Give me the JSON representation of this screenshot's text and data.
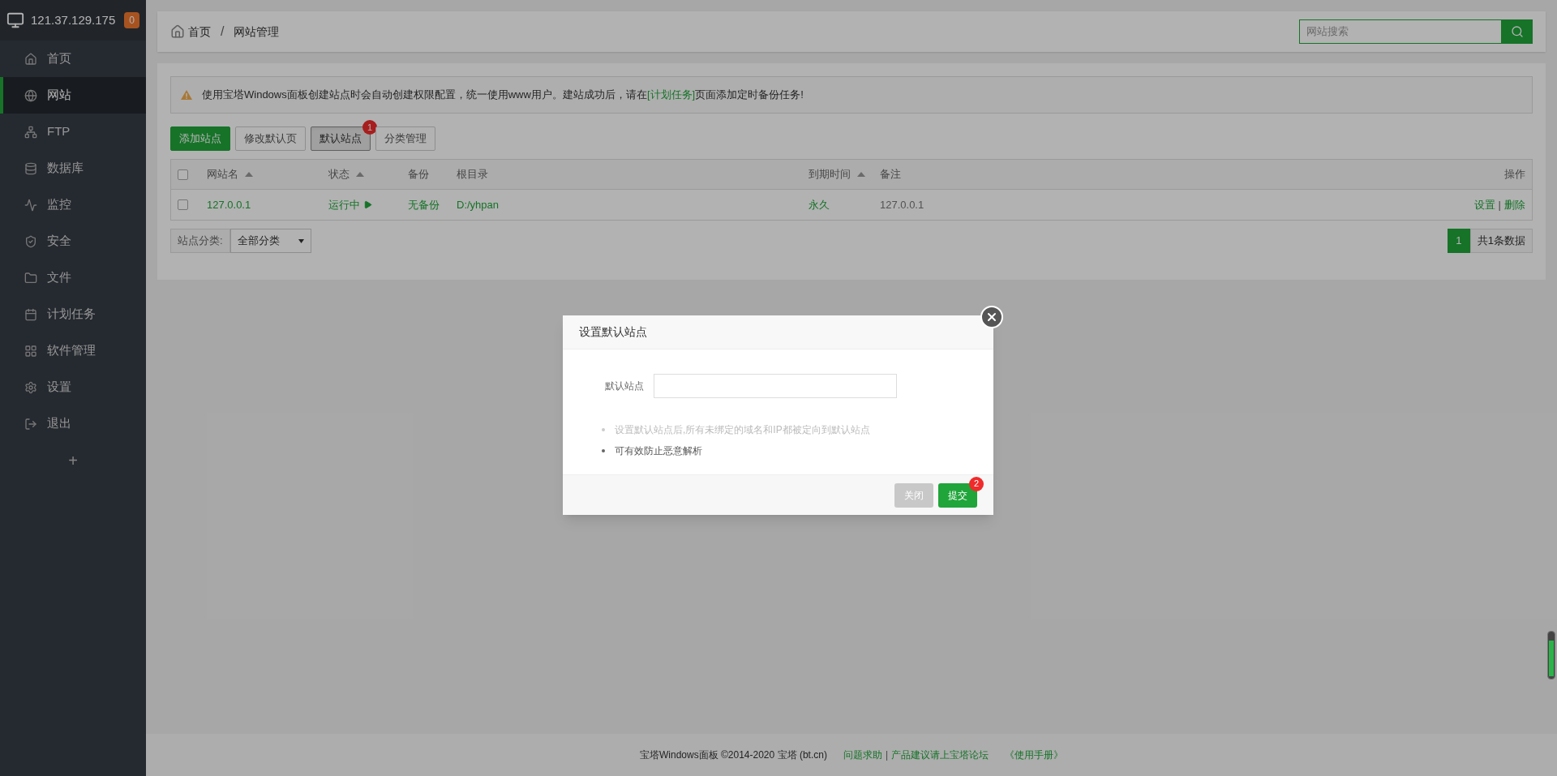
{
  "sidebar": {
    "host": "121.37.129.175",
    "badge": "0",
    "items": [
      {
        "label": "首页",
        "selected": false
      },
      {
        "label": "网站",
        "selected": true
      },
      {
        "label": "FTP",
        "selected": false
      },
      {
        "label": "数据库",
        "selected": false
      },
      {
        "label": "监控",
        "selected": false
      },
      {
        "label": "安全",
        "selected": false
      },
      {
        "label": "文件",
        "selected": false
      },
      {
        "label": "计划任务",
        "selected": false
      },
      {
        "label": "软件管理",
        "selected": false
      },
      {
        "label": "设置",
        "selected": false
      },
      {
        "label": "退出",
        "selected": false
      }
    ],
    "add_button": "+"
  },
  "breadcrumb": [
    "首页",
    "网站管理"
  ],
  "breadcrumb_separator": "/",
  "action_separator": "|",
  "search": {
    "placeholder": "网站搜索"
  },
  "alert": {
    "text": "使用宝塔Windows面板创建站点时会自动创建权限配置，统一使用www用户。建站成功后，请在",
    "link": "[计划任务]",
    "text_after": "页面添加定时备份任务!"
  },
  "toolbar": [
    {
      "label": "添加站点",
      "kind": "primary",
      "pressed": false
    },
    {
      "label": "修改默认页",
      "kind": "default",
      "pressed": false
    },
    {
      "label": "默认站点",
      "kind": "default",
      "pressed": true,
      "marker": "1"
    },
    {
      "label": "分类管理",
      "kind": "default",
      "pressed": false
    }
  ],
  "table": {
    "columns": [
      {
        "label": "网站名",
        "sortable": true
      },
      {
        "label": "状态",
        "sortable": true
      },
      {
        "label": "备份",
        "sortable": false
      },
      {
        "label": "根目录",
        "sortable": false
      },
      {
        "label": "到期时间",
        "sortable": true
      },
      {
        "label": "备注",
        "sortable": false
      },
      {
        "label": "操作",
        "sortable": false
      }
    ],
    "header_checked": false,
    "rows": [
      {
        "checked": false,
        "name": "127.0.0.1",
        "status": "运行中",
        "running": true,
        "backup": "无备份",
        "root": "D:/yhpan",
        "expiry": "永久",
        "note": "127.0.0.1",
        "actions": [
          "设置",
          "删除"
        ]
      }
    ]
  },
  "filter": {
    "label": "站点分类:",
    "value": "全部分类"
  },
  "pagination": {
    "pages": [
      {
        "label": "1",
        "selected": true
      }
    ],
    "total": "共1条数据"
  },
  "dialog": {
    "title": "设置默认站点",
    "field_label": "默认站点",
    "notes": [
      {
        "text": "设置默认站点后,所有未绑定的域名和IP都被定向到默认站点",
        "muted": true
      },
      {
        "text": "可有效防止恶意解析",
        "muted": false
      }
    ],
    "buttons": [
      {
        "label": "关闭",
        "kind": "secondary"
      },
      {
        "label": "提交",
        "kind": "primary",
        "marker": "2"
      }
    ]
  },
  "footer": {
    "copyright": "宝塔Windows面板 ©2014-2020 宝塔 (bt.cn)",
    "links": [
      "问题求助",
      "产品建议请上宝塔论坛"
    ],
    "link_separator": "|",
    "manual": "《使用手册》"
  }
}
